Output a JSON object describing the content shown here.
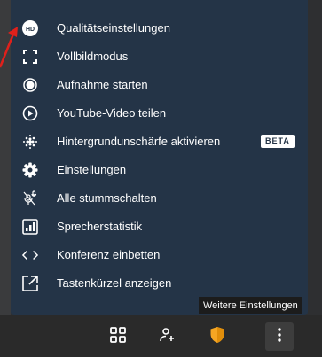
{
  "menu": {
    "items": [
      {
        "label": "Qualitätseinstellungen",
        "icon": "hd-icon",
        "badge": "HD"
      },
      {
        "label": "Vollbildmodus",
        "icon": "fullscreen-icon"
      },
      {
        "label": "Aufnahme starten",
        "icon": "record-icon"
      },
      {
        "label": "YouTube-Video teilen",
        "icon": "play-circle-icon"
      },
      {
        "label": "Hintergrundunschärfe aktivieren",
        "icon": "blur-icon",
        "tag": "BETA"
      },
      {
        "label": "Einstellungen",
        "icon": "gear-icon"
      },
      {
        "label": "Alle stummschalten",
        "icon": "mute-all-icon"
      },
      {
        "label": "Sprecherstatistik",
        "icon": "speaker-stats-icon"
      },
      {
        "label": "Konferenz einbetten",
        "icon": "code-icon"
      },
      {
        "label": "Tastenkürzel anzeigen",
        "icon": "external-icon"
      }
    ]
  },
  "tooltip": {
    "text": "Weitere Einstellungen"
  },
  "toolbar": {
    "buttons": [
      "tile-view-icon",
      "invite-icon",
      "security-shield-icon",
      "more-actions-icon"
    ]
  },
  "colors": {
    "menu_bg": "#243447",
    "toolbar_bg": "#2a2a2a",
    "shield": "#f5a623",
    "annotation_arrow": "#e0201b"
  }
}
